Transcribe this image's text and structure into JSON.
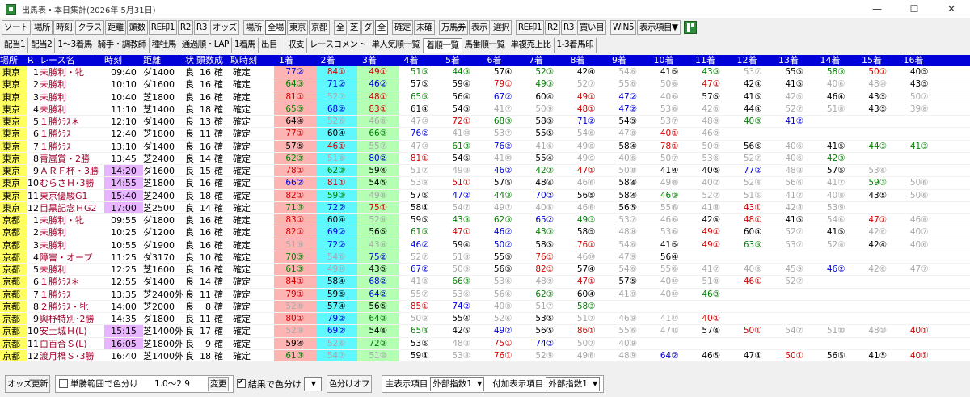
{
  "title": "出馬表・本日集計(2026年 5月31日)",
  "window": {
    "minimize": "—",
    "maximize": "☐",
    "close": "✕"
  },
  "toolbar1": [
    "ソート",
    "場所",
    "時刻",
    "クラス",
    "距離",
    "頭数",
    "RE印1",
    "R2",
    "R3",
    "オッズ",
    "場所",
    "全場",
    "東京",
    "京都",
    "全",
    "芝",
    "ダ",
    "全",
    "確定",
    "未確",
    "万馬券",
    "表示",
    "選択",
    "RE印1",
    "R2",
    "R3",
    "買い目",
    "WIN5",
    "表示項目▼"
  ],
  "toolbar2": [
    "配当1",
    "配当2",
    "1～3着馬",
    "騎手・調教師",
    "種牡馬",
    "通過順・LAP",
    "1着馬",
    "出目",
    "収支",
    "レースコメント",
    "単人気順一覧",
    "着順一覧",
    "馬番順一覧",
    "単複売上比",
    "1-3着馬印"
  ],
  "columns": [
    "場所",
    "R",
    "レース名",
    "時刻",
    "距離",
    "状",
    "頭数",
    "成",
    "取時刻",
    "1着",
    "2着",
    "3着",
    "4着",
    "5着",
    "6着",
    "7着",
    "8着",
    "9着",
    "10着",
    "11着",
    "12着",
    "13着",
    "14着",
    "15着",
    "16着"
  ],
  "rows": [
    {
      "venue": "東京",
      "r": "1",
      "name": "未勝利・牝",
      "time": "09:40",
      "dist": "ダ1400",
      "cond": "良",
      "heads": "16",
      "fix": "確",
      "stat": "確定",
      "ranks": [
        "77②",
        "84①",
        "49①",
        "51③",
        "44③",
        "57④",
        "52③",
        "42④",
        "54⑥",
        "41⑤",
        "43③",
        "53⑦",
        "55⑤",
        "58③",
        "50①",
        "40⑤"
      ]
    },
    {
      "venue": "東京",
      "r": "2",
      "name": "未勝利",
      "time": "10:10",
      "dist": "ダ1600",
      "cond": "良",
      "heads": "16",
      "fix": "確",
      "stat": "確定",
      "ranks": [
        "64③",
        "71②",
        "46②",
        "57⑤",
        "59④",
        "79①",
        "49③",
        "52⑦",
        "55⑥",
        "50⑧",
        "47①",
        "42④",
        "41⑤",
        "40⑥",
        "48⑩",
        "43⑤"
      ]
    },
    {
      "venue": "東京",
      "r": "3",
      "name": "未勝利",
      "time": "10:40",
      "dist": "芝1800",
      "cond": "良",
      "heads": "16",
      "fix": "確",
      "stat": "確定",
      "ranks": [
        "81①",
        "52⑦",
        "48①",
        "65③",
        "56④",
        "67②",
        "60④",
        "49①",
        "47②",
        "40⑥",
        "57⑤",
        "41⑤",
        "42⑥",
        "46④",
        "43⑤",
        "50⑦"
      ]
    },
    {
      "venue": "東京",
      "r": "4",
      "name": "未勝利",
      "time": "11:10",
      "dist": "芝1400",
      "cond": "良",
      "heads": "18",
      "fix": "確",
      "stat": "確定",
      "ranks": [
        "65③",
        "68②",
        "83①",
        "61④",
        "54⑤",
        "41⑦",
        "50⑨",
        "48①",
        "47②",
        "53⑥",
        "42⑥",
        "44④",
        "52⑦",
        "51⑧",
        "43⑤",
        "39⑧"
      ]
    },
    {
      "venue": "東京",
      "r": "5",
      "name": "１勝ｸﾗｽ＊",
      "time": "12:10",
      "dist": "ダ1400",
      "cond": "良",
      "heads": "13",
      "fix": "確",
      "stat": "確定",
      "ranks": [
        "64④",
        "52⑥",
        "46⑥",
        "47⑩",
        "72①",
        "68③",
        "58⑤",
        "71②",
        "54⑤",
        "53⑦",
        "48⑨",
        "40③",
        "41②",
        "",
        "",
        ""
      ]
    },
    {
      "venue": "東京",
      "r": "6",
      "name": "１勝ｸﾗｽ",
      "time": "12:40",
      "dist": "芝1800",
      "cond": "良",
      "heads": "11",
      "fix": "確",
      "stat": "確定",
      "ranks": [
        "77①",
        "60④",
        "66③",
        "76②",
        "41⑩",
        "53⑦",
        "55⑤",
        "54⑥",
        "47⑧",
        "40①",
        "46⑨",
        "",
        "",
        "",
        "",
        ""
      ]
    },
    {
      "venue": "東京",
      "r": "7",
      "name": "１勝ｸﾗｽ",
      "time": "13:10",
      "dist": "ダ1400",
      "cond": "良",
      "heads": "16",
      "fix": "確",
      "stat": "確定",
      "ranks": [
        "57⑤",
        "46①",
        "55⑦",
        "47⑩",
        "61③",
        "76②",
        "41⑥",
        "49⑧",
        "58④",
        "78①",
        "50⑨",
        "56⑤",
        "40⑥",
        "41⑤",
        "44③",
        "41③"
      ]
    },
    {
      "venue": "東京",
      "r": "8",
      "name": "青嵐賞・2勝",
      "time": "13:45",
      "dist": "芝2400",
      "cond": "良",
      "heads": "14",
      "fix": "確",
      "stat": "確定",
      "ranks": [
        "62③",
        "51⑧",
        "80②",
        "81①",
        "54⑤",
        "41⑩",
        "55④",
        "49⑨",
        "40⑥",
        "50⑦",
        "53⑥",
        "52⑦",
        "40⑥",
        "42③",
        "",
        ""
      ]
    },
    {
      "venue": "東京",
      "r": "9",
      "name": "ＡＲＦ杯・3勝",
      "time": "14:20",
      "dist": "ダ1600",
      "cond": "良",
      "heads": "15",
      "fix": "確",
      "stat": "確定",
      "ranks": [
        "78①",
        "62③",
        "59④",
        "51⑦",
        "49⑨",
        "46②",
        "42③",
        "47①",
        "50⑧",
        "41④",
        "40⑤",
        "77②",
        "48⑧",
        "57⑤",
        "53⑥",
        ""
      ]
    },
    {
      "venue": "東京",
      "r": "10",
      "name": "むらさＨ･3勝",
      "time": "14:55",
      "dist": "芝1800",
      "cond": "良",
      "heads": "16",
      "fix": "確",
      "stat": "確定",
      "ranks": [
        "66②",
        "81①",
        "54⑤",
        "53⑨",
        "51①",
        "57⑤",
        "48④",
        "46⑥",
        "58④",
        "49⑧",
        "40⑦",
        "52⑧",
        "56⑥",
        "41⑦",
        "59③",
        "50⑥"
      ]
    },
    {
      "venue": "東京",
      "r": "11",
      "name": "東京優駿G1",
      "time": "15:40",
      "dist": "芝2400",
      "cond": "良",
      "heads": "18",
      "fix": "確",
      "stat": "確定",
      "ranks": [
        "82①",
        "59③",
        "49⑧",
        "57⑤",
        "47②",
        "44③",
        "70②",
        "56⑤",
        "58④",
        "46③",
        "52⑦",
        "51⑥",
        "41⑦",
        "40⑧",
        "43⑤",
        "50⑥"
      ]
    },
    {
      "venue": "東京",
      "r": "12",
      "name": "目黒記念ＨG2",
      "time": "17:00",
      "dist": "芝2500",
      "cond": "良",
      "heads": "14",
      "fix": "確",
      "stat": "確定",
      "ranks": [
        "71③",
        "72②",
        "75①",
        "58④",
        "54⑦",
        "49⑦",
        "40⑥",
        "46⑥",
        "56⑤",
        "55⑥",
        "41⑧",
        "43①",
        "42⑧",
        "53⑨",
        "",
        ""
      ]
    },
    {
      "venue": "京都",
      "r": "1",
      "name": "未勝利・牝",
      "time": "09:55",
      "dist": "ダ1800",
      "cond": "良",
      "heads": "16",
      "fix": "確",
      "stat": "確定",
      "ranks": [
        "83①",
        "60④",
        "52⑧",
        "59⑤",
        "43③",
        "62③",
        "65②",
        "49③",
        "53⑦",
        "46⑥",
        "42④",
        "48①",
        "41⑤",
        "54⑥",
        "47①",
        "46⑧"
      ]
    },
    {
      "venue": "京都",
      "r": "2",
      "name": "未勝利",
      "time": "10:25",
      "dist": "ダ1200",
      "cond": "良",
      "heads": "16",
      "fix": "確",
      "stat": "確定",
      "ranks": [
        "82①",
        "69②",
        "56⑤",
        "61③",
        "47①",
        "46②",
        "43③",
        "58⑤",
        "48⑧",
        "53⑥",
        "49①",
        "60④",
        "52⑦",
        "41⑤",
        "42⑥",
        "40⑦"
      ]
    },
    {
      "venue": "京都",
      "r": "3",
      "name": "未勝利",
      "time": "10:55",
      "dist": "ダ1900",
      "cond": "良",
      "heads": "16",
      "fix": "確",
      "stat": "確定",
      "ranks": [
        "51⑨",
        "72②",
        "43⑧",
        "46②",
        "59④",
        "50②",
        "58⑤",
        "76①",
        "54⑥",
        "41⑤",
        "49①",
        "63③",
        "53⑦",
        "52⑧",
        "42④",
        "40⑥"
      ]
    },
    {
      "venue": "京都",
      "r": "4",
      "name": "障害・オープ",
      "time": "11:25",
      "dist": "ダ3170",
      "cond": "良",
      "heads": "10",
      "fix": "確",
      "stat": "確定",
      "ranks": [
        "70③",
        "54⑥",
        "75②",
        "52⑦",
        "51⑧",
        "55⑤",
        "76①",
        "46⑩",
        "47⑨",
        "56④",
        "",
        "",
        "",
        "",
        "",
        ""
      ]
    },
    {
      "venue": "京都",
      "r": "5",
      "name": "未勝利",
      "time": "12:25",
      "dist": "芝1600",
      "cond": "良",
      "heads": "16",
      "fix": "確",
      "stat": "確定",
      "ranks": [
        "61③",
        "49⑩",
        "43⑤",
        "67②",
        "50⑨",
        "56⑤",
        "82①",
        "57④",
        "54⑥",
        "55⑥",
        "41⑦",
        "40⑧",
        "45⑨",
        "46②",
        "42⑥",
        "47⑦"
      ]
    },
    {
      "venue": "京都",
      "r": "6",
      "name": "１勝ｸﾗｽ＊",
      "time": "12:55",
      "dist": "ダ1400",
      "cond": "良",
      "heads": "14",
      "fix": "確",
      "stat": "確定",
      "ranks": [
        "84①",
        "58④",
        "68②",
        "41⑧",
        "66③",
        "53⑥",
        "48⑨",
        "47①",
        "57⑤",
        "40⑩",
        "51⑧",
        "46①",
        "52⑦",
        "",
        "",
        ""
      ]
    },
    {
      "venue": "京都",
      "r": "7",
      "name": "１勝ｸﾗｽ",
      "time": "13:35",
      "dist": "芝2400外",
      "cond": "良",
      "heads": "11",
      "fix": "確",
      "stat": "確定",
      "ranks": [
        "79①",
        "59⑤",
        "64②",
        "55⑦",
        "53⑥",
        "56⑥",
        "62③",
        "60④",
        "41⑨",
        "40⑩",
        "46③",
        "",
        "",
        "",
        "",
        ""
      ]
    },
    {
      "venue": "京都",
      "r": "8",
      "name": "２勝ｸﾗｽ・牝",
      "time": "14:00",
      "dist": "芝2000",
      "cond": "良",
      "heads": "8",
      "fix": "確",
      "stat": "確定",
      "ranks": [
        "52⑥",
        "57④",
        "56⑤",
        "85①",
        "74②",
        "40⑧",
        "51⑦",
        "58③",
        "",
        "",
        "",
        "",
        "",
        "",
        "",
        ""
      ]
    },
    {
      "venue": "京都",
      "r": "9",
      "name": "與杼特別･2勝",
      "time": "14:35",
      "dist": "ダ1800",
      "cond": "良",
      "heads": "11",
      "fix": "確",
      "stat": "確定",
      "ranks": [
        "80①",
        "79②",
        "64③",
        "50⑨",
        "55④",
        "52⑥",
        "53⑤",
        "51⑦",
        "46⑨",
        "41⑩",
        "40①",
        "",
        "",
        "",
        "",
        ""
      ]
    },
    {
      "venue": "京都",
      "r": "10",
      "name": "安土城Ｈ(L)",
      "time": "15:15",
      "dist": "芝1400外",
      "cond": "良",
      "heads": "17",
      "fix": "確",
      "stat": "確定",
      "ranks": [
        "52⑨",
        "69②",
        "54④",
        "65③",
        "42⑤",
        "49②",
        "56⑤",
        "86①",
        "55⑥",
        "47⑩",
        "57④",
        "50①",
        "54⑦",
        "51⑩",
        "48⑩",
        "40①"
      ]
    },
    {
      "venue": "京都",
      "r": "11",
      "name": "白百合Ｓ(L)",
      "time": "16:05",
      "dist": "芝1800外",
      "cond": "良",
      "heads": "9",
      "fix": "確",
      "stat": "確定",
      "ranks": [
        "59④",
        "52⑥",
        "72③",
        "53⑤",
        "48⑧",
        "75①",
        "74②",
        "50⑦",
        "40⑨",
        "",
        "",
        "",
        "",
        "",
        "",
        ""
      ]
    },
    {
      "venue": "京都",
      "r": "12",
      "name": "渡月橋Ｓ･3勝",
      "time": "16:40",
      "dist": "芝1400外",
      "cond": "良",
      "heads": "18",
      "fix": "確",
      "stat": "確定",
      "ranks": [
        "61③",
        "54⑦",
        "51⑩",
        "59④",
        "53⑧",
        "76①",
        "52⑨",
        "49⑥",
        "48⑨",
        "64②",
        "46⑤",
        "47④",
        "50①",
        "56⑤",
        "41⑤",
        "40①"
      ]
    }
  ],
  "colors": {
    "header_bg": "#0000d8",
    "venue_bg": "#ffff60",
    "rank1_bg": "#ffb4b4",
    "rank2_bg": "#60f8ff",
    "rank3_bg": "#b4ffb4",
    "highlight_time_bg": "#e8b4ff"
  },
  "bottom": {
    "odds_update": "オッズ更新",
    "range_label": "単勝範囲で色分け",
    "range_value": "1.0～2.9",
    "change": "変更",
    "result_color": "結果で色分け",
    "color_off": "色分けオフ",
    "main_item_label": "主表示項目",
    "main_item_value": "外部指数1",
    "sub_item_label": "付加表示項目",
    "sub_item_value": "外部指数1"
  }
}
